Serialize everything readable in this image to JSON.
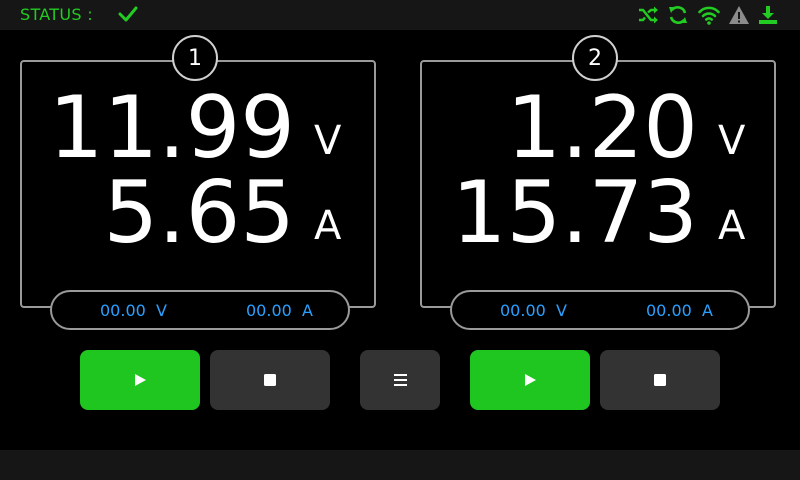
{
  "status": {
    "label": "STATUS :",
    "color": "#22cc22",
    "icons": [
      "check-icon",
      "shuffle-icon",
      "refresh-icon",
      "wifi-icon",
      "warning-icon",
      "download-icon"
    ]
  },
  "channels": [
    {
      "number": "1",
      "voltage": "11.99",
      "voltage_unit": "V",
      "current": "5.65",
      "current_unit": "A",
      "set_voltage": "00.00",
      "set_voltage_unit": "V",
      "set_current": "00.00",
      "set_current_unit": "A"
    },
    {
      "number": "2",
      "voltage": "1.20",
      "voltage_unit": "V",
      "current": "15.73",
      "current_unit": "A",
      "set_voltage": "00.00",
      "set_voltage_unit": "V",
      "set_current": "00.00",
      "set_current_unit": "A"
    }
  ],
  "controls": {
    "play_icon": "play-icon",
    "stop_icon": "stop-icon",
    "menu_icon": "menu-icon"
  },
  "colors": {
    "accent_green": "#1fc61f",
    "setpoint_blue": "#2aa0ff",
    "button_gray": "#333333"
  }
}
